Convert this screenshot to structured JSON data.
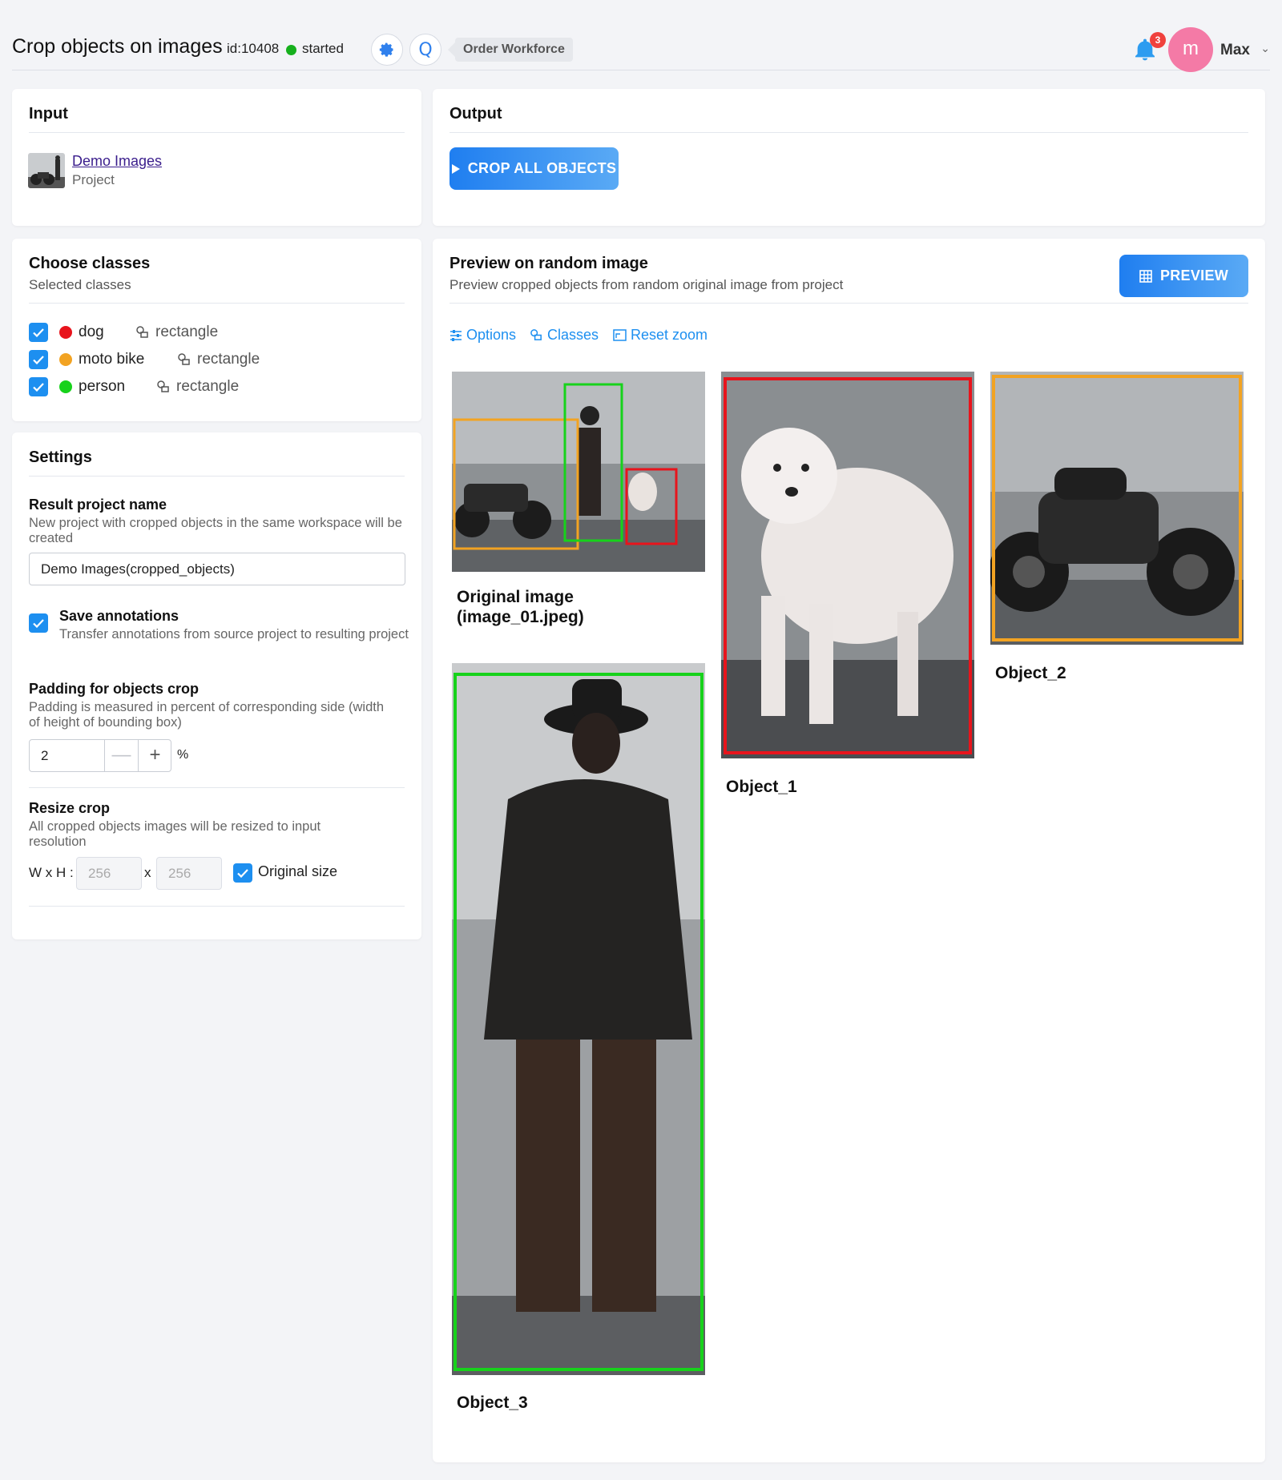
{
  "header": {
    "title": "Crop objects on images",
    "app_id": "id:10408",
    "status": "started",
    "order_workforce": "Order Workforce",
    "notifications_count": "3",
    "avatar_letter": "m",
    "user_name": "Max"
  },
  "input": {
    "title": "Input",
    "project_name": "Demo Images",
    "project_type": "Project"
  },
  "output": {
    "title": "Output",
    "crop_button": "CROP ALL OBJECTS"
  },
  "classes": {
    "title": "Choose classes",
    "subtitle": "Selected classes",
    "items": [
      {
        "name": "dog",
        "shape": "rectangle",
        "color": "#e8141c",
        "checked": true
      },
      {
        "name": "moto bike",
        "shape": "rectangle",
        "color": "#f2a322",
        "checked": true
      },
      {
        "name": "person",
        "shape": "rectangle",
        "color": "#17d21b",
        "checked": true
      }
    ]
  },
  "settings": {
    "title": "Settings",
    "result_name_label": "Result project name",
    "result_name_desc": "New project with cropped objects in the same workspace will be created",
    "result_name_value": "Demo Images(cropped_objects)",
    "save_ann_label": "Save annotations",
    "save_ann_desc": "Transfer annotations from source project to resulting project",
    "save_ann_checked": true,
    "padding_label": "Padding for objects crop",
    "padding_desc": "Padding is measured in percent of corresponding side (width of height of bounding box)",
    "padding_value": "2",
    "padding_unit": "%",
    "resize_label": "Resize crop",
    "resize_desc": "All cropped objects images will be resized to input resolution",
    "wh_label": "W x H :",
    "width_placeholder": "256",
    "height_placeholder": "256",
    "x_sep": "x",
    "original_size_label": "Original size",
    "original_size_checked": true
  },
  "preview": {
    "title": "Preview on random image",
    "desc": "Preview cropped objects from random original image from project",
    "button": "PREVIEW",
    "toolbar": {
      "options": "Options",
      "classes": "Classes",
      "reset_zoom": "Reset zoom"
    },
    "images": {
      "original": "Original image\n(image_01.jpeg)",
      "object_1": "Object_1",
      "object_2": "Object_2",
      "object_3": "Object_3"
    }
  },
  "colors": {
    "accent": "#1d8ff0",
    "status_ok": "#16b01d",
    "dog": "#e8141c",
    "moto": "#f2a322",
    "person": "#17d21b",
    "avatar": "#f47aa6",
    "notification": "#f0413d"
  }
}
